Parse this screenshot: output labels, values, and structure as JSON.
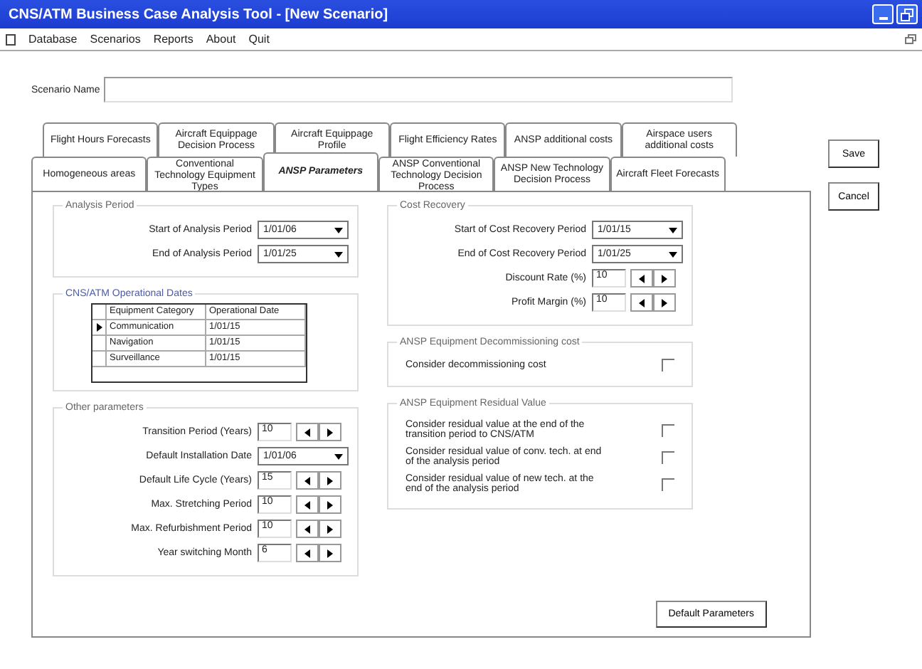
{
  "window": {
    "title": "CNS/ATM Business Case Analysis Tool - [New Scenario]"
  },
  "menu": [
    "Database",
    "Scenarios",
    "Reports",
    "About",
    "Quit"
  ],
  "scenario_name": {
    "label": "Scenario Name"
  },
  "tab_rows": [
    [
      {
        "label": "Flight Hours Forecasts",
        "selected": false
      },
      {
        "label": "Aircraft Equippage Decision Process",
        "selected": false
      },
      {
        "label": "Aircraft Equippage Profile",
        "selected": false
      },
      {
        "label": "Flight Efficiency Rates",
        "selected": false
      },
      {
        "label": "ANSP additional costs",
        "selected": false
      },
      {
        "label": "Airspace users additional costs",
        "selected": false
      }
    ],
    [
      {
        "label": "Homogeneous areas",
        "selected": false
      },
      {
        "label": "Conventional Technology Equipment Types",
        "selected": false
      },
      {
        "label": "ANSP Parameters",
        "selected": true
      },
      {
        "label": "ANSP Conventional Technology Decision Process",
        "selected": false
      },
      {
        "label": "ANSP New Technology Decision Process",
        "selected": false
      },
      {
        "label": "Aircraft Fleet Forecasts",
        "selected": false
      }
    ]
  ],
  "buttons": [
    "Save",
    "Cancel"
  ],
  "analysis_period": {
    "title": "Analysis Period",
    "fields": [
      {
        "kind": "dropdown",
        "label": "Start of Analysis Period",
        "value": "1/01/06"
      },
      {
        "kind": "dropdown",
        "label": "End of Analysis Period",
        "value": "1/01/25"
      }
    ]
  },
  "operational_dates": {
    "title": "CNS/ATM Operational Dates",
    "columns": [
      "Equipment Category",
      "Operational Date"
    ],
    "rows": [
      {
        "current": true,
        "cells": [
          "Communication",
          "1/01/15"
        ]
      },
      {
        "current": false,
        "cells": [
          "Navigation",
          "1/01/15"
        ]
      },
      {
        "current": false,
        "cells": [
          "Surveillance",
          "1/01/15"
        ]
      }
    ]
  },
  "other_parameters": {
    "title": "Other parameters",
    "fields": [
      {
        "kind": "spin",
        "label": "Transition Period (Years)",
        "value": "10"
      },
      {
        "kind": "dropdown",
        "label": "Default Installation Date",
        "value": "1/01/06"
      },
      {
        "kind": "spin",
        "label": "Default Life Cycle (Years)",
        "value": "15"
      },
      {
        "kind": "spin",
        "label": "Max. Stretching Period",
        "value": "10"
      },
      {
        "kind": "spin",
        "label": "Max. Refurbishment Period",
        "value": "10"
      },
      {
        "kind": "spin",
        "label": "Year switching Month",
        "value": "6"
      }
    ]
  },
  "cost_recovery": {
    "title": "Cost Recovery",
    "fields": [
      {
        "kind": "dropdown",
        "label": "Start of Cost Recovery Period",
        "value": "1/01/15"
      },
      {
        "kind": "dropdown",
        "label": "End of Cost Recovery Period",
        "value": "1/01/25"
      },
      {
        "kind": "spin",
        "label": "Discount Rate (%)",
        "value": "10"
      },
      {
        "kind": "spin",
        "label": "Profit Margin (%)",
        "value": "10"
      }
    ]
  },
  "decommissioning": {
    "title": "ANSP Equipment Decommissioning cost",
    "options": [
      {
        "label": "Consider decommissioning cost",
        "checked": false
      }
    ]
  },
  "residual_value": {
    "title": "ANSP Equipment Residual Value",
    "options": [
      {
        "label": "Consider residual value at the end of the transition period to CNS/ATM",
        "checked": false
      },
      {
        "label": "Consider residual value of conv. tech. at end of the analysis period",
        "checked": false
      },
      {
        "label": "Consider residual value of new tech. at the end of the analysis period",
        "checked": false
      }
    ]
  },
  "default_button": "Default Parameters"
}
